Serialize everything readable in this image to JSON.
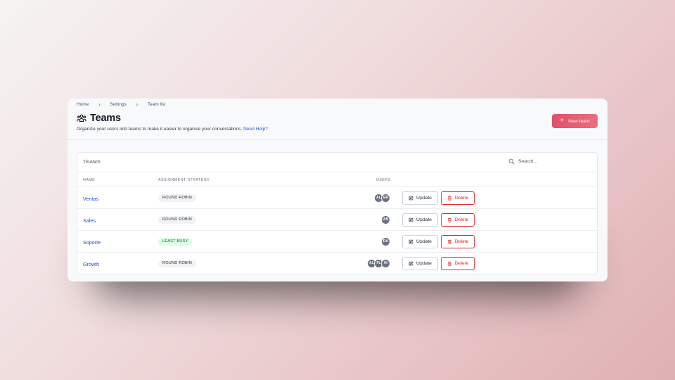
{
  "breadcrumb": [
    "Home",
    "Settings",
    "Team list"
  ],
  "page": {
    "title": "Teams",
    "icon": "users-group-icon",
    "subtitle": "Organize your users into teams to make it easier to organise your conversations.",
    "help_link": "Need Help?",
    "new_team_label": "New team"
  },
  "panel": {
    "title": "TEAMS",
    "search_placeholder": "Search...",
    "columns": {
      "name": "NAME",
      "strategy": "ASSIGNMENT STRATEGY",
      "users": "USERS"
    }
  },
  "teams": [
    {
      "name": "Ventas",
      "strategy": "ROUND ROBIN",
      "users": [
        "AL",
        "ER"
      ]
    },
    {
      "name": "Sales",
      "strategy": "ROUND ROBIN",
      "users": [
        "AN"
      ]
    },
    {
      "name": "Soporte",
      "strategy": "LEAST BUSY",
      "users": [
        "DA"
      ]
    },
    {
      "name": "Growth",
      "strategy": "ROUND ROBIN",
      "users": [
        "AL",
        "FL",
        "HI"
      ]
    }
  ],
  "actions": {
    "update_label": "Update",
    "delete_label": "Delete"
  },
  "colors": {
    "accent": "#e0506a",
    "link": "#1d4ed8",
    "danger": "#dc2626",
    "least_busy_bg": "#dcfce7"
  }
}
